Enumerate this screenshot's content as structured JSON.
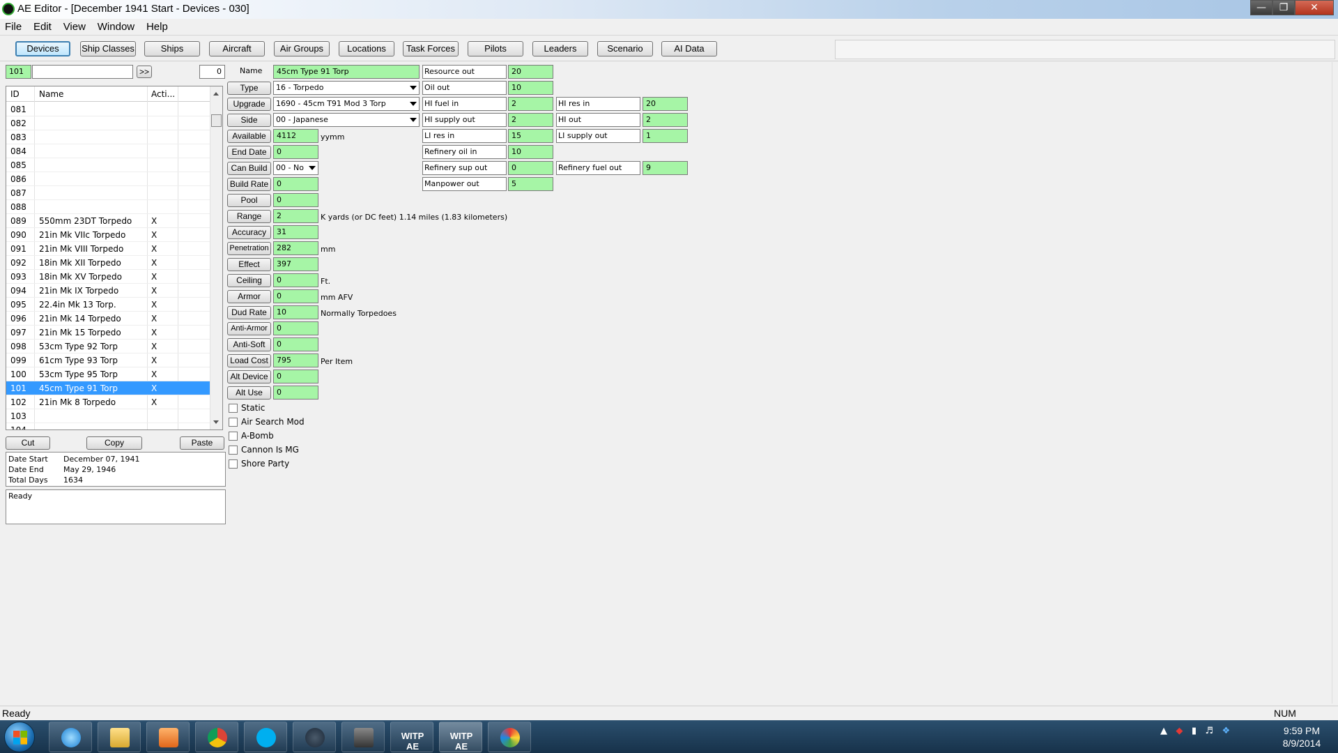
{
  "window": {
    "title": "AE Editor - [December 1941 Start - Devices - 030]"
  },
  "menu": [
    "File",
    "Edit",
    "View",
    "Window",
    "Help"
  ],
  "tabs": [
    "Devices",
    "Ship Classes",
    "Ships",
    "Aircraft",
    "Air Groups",
    "Locations",
    "Task Forces",
    "Pilots",
    "Leaders",
    "Scenario",
    "AI Data"
  ],
  "search": {
    "id_value": "101",
    "text_value": "",
    "go_label": ">>",
    "count_value": "0"
  },
  "list": {
    "headers": {
      "id": "ID",
      "name": "Name",
      "active": "Acti..."
    },
    "rows": [
      {
        "id": "081",
        "name": "",
        "active": ""
      },
      {
        "id": "082",
        "name": "",
        "active": ""
      },
      {
        "id": "083",
        "name": "",
        "active": ""
      },
      {
        "id": "084",
        "name": "",
        "active": ""
      },
      {
        "id": "085",
        "name": "",
        "active": ""
      },
      {
        "id": "086",
        "name": "",
        "active": ""
      },
      {
        "id": "087",
        "name": "",
        "active": ""
      },
      {
        "id": "088",
        "name": "",
        "active": ""
      },
      {
        "id": "089",
        "name": "550mm 23DT Torpedo",
        "active": "X"
      },
      {
        "id": "090",
        "name": "21in Mk VIIc Torpedo",
        "active": "X"
      },
      {
        "id": "091",
        "name": "21in Mk VIII Torpedo",
        "active": "X"
      },
      {
        "id": "092",
        "name": "18in Mk XII Torpedo",
        "active": "X"
      },
      {
        "id": "093",
        "name": "18in Mk XV Torpedo",
        "active": "X"
      },
      {
        "id": "094",
        "name": "21in Mk IX Torpedo",
        "active": "X"
      },
      {
        "id": "095",
        "name": "22.4in Mk 13 Torp.",
        "active": "X"
      },
      {
        "id": "096",
        "name": "21in Mk 14 Torpedo",
        "active": "X"
      },
      {
        "id": "097",
        "name": "21in Mk 15 Torpedo",
        "active": "X"
      },
      {
        "id": "098",
        "name": "53cm Type 92 Torp",
        "active": "X"
      },
      {
        "id": "099",
        "name": "61cm Type 93 Torp",
        "active": "X"
      },
      {
        "id": "100",
        "name": "53cm Type 95 Torp",
        "active": "X"
      },
      {
        "id": "101",
        "name": "45cm Type 91 Torp",
        "active": "X",
        "selected": true
      },
      {
        "id": "102",
        "name": "21in Mk 8 Torpedo",
        "active": "X"
      },
      {
        "id": "103",
        "name": "",
        "active": ""
      },
      {
        "id": "104",
        "name": "",
        "active": ""
      }
    ]
  },
  "clipboard": {
    "cut": "Cut",
    "copy": "Copy",
    "paste": "Paste"
  },
  "dates": {
    "start_label": "Date Start",
    "start_value": "December 07, 1941",
    "end_label": "Date End",
    "end_value": "May 29, 1946",
    "total_label": "Total Days",
    "total_value": "1634"
  },
  "status_box": "Ready",
  "form": {
    "name_label": "Name",
    "name_value": "45cm Type 91 Torp",
    "type_label": "Type",
    "type_value": "16 - Torpedo",
    "upgrade_label": "Upgrade",
    "upgrade_value": "1690 - 45cm T91 Mod 3 Torp",
    "side_label": "Side",
    "side_value": "00 - Japanese",
    "available_label": "Available",
    "available_value": "4112",
    "available_unit": "yymm",
    "enddate_label": "End Date",
    "enddate_value": "0",
    "canbuild_label": "Can Build",
    "canbuild_value": "00 - No",
    "buildrate_label": "Build Rate",
    "buildrate_value": "0",
    "pool_label": "Pool",
    "pool_value": "0",
    "range_label": "Range",
    "range_value": "2",
    "range_unit": "K yards  (or DC feet)  1.14 miles  (1.83 kilometers)",
    "accuracy_label": "Accuracy",
    "accuracy_value": "31",
    "penetration_label": "Penetration",
    "penetration_value": "282",
    "penetration_unit": "mm",
    "effect_label": "Effect",
    "effect_value": "397",
    "ceiling_label": "Ceiling",
    "ceiling_value": "0",
    "ceiling_unit": "Ft.",
    "armor_label": "Armor",
    "armor_value": "0",
    "armor_unit": "mm AFV",
    "dudrate_label": "Dud Rate",
    "dudrate_value": "10",
    "dudrate_unit": "Normally Torpedoes",
    "antiarmor_label": "Anti-Armor",
    "antiarmor_value": "0",
    "antisoft_label": "Anti-Soft",
    "antisoft_value": "0",
    "loadcost_label": "Load Cost",
    "loadcost_value": "795",
    "loadcost_unit": "Per Item",
    "altdevice_label": "Alt Device",
    "altdevice_value": "0",
    "altuse_label": "Alt Use",
    "altuse_value": "0"
  },
  "checkboxes": [
    "Static",
    "Air Search Mod",
    "A-Bomb",
    "Cannon Is MG",
    "Shore Party"
  ],
  "resources": {
    "resource_out_label": "Resource out",
    "resource_out_value": "20",
    "oil_out_label": "Oil out",
    "oil_out_value": "10",
    "hi_fuel_in_label": "HI fuel in",
    "hi_fuel_in_value": "2",
    "hi_supply_out_label": "HI supply out",
    "hi_supply_out_value": "2",
    "li_res_in_label": "LI res in",
    "li_res_in_value": "15",
    "refinery_oil_in_label": "Refinery oil in",
    "refinery_oil_in_value": "10",
    "refinery_sup_out_label": "Refinery sup out",
    "refinery_sup_out_value": "0",
    "manpower_out_label": "Manpower out",
    "manpower_out_value": "5",
    "hi_res_in_label": "HI res in",
    "hi_res_in_value": "20",
    "hi_out_label": "HI out",
    "hi_out_value": "2",
    "li_supply_out_label": "LI supply out",
    "li_supply_out_value": "1",
    "refinery_fuel_out_label": "Refinery fuel out",
    "refinery_fuel_out_value": "9"
  },
  "statusbar": {
    "text": "Ready",
    "num": "NUM"
  },
  "taskbar": {
    "items": [
      "start-icon",
      "internet-explorer-icon",
      "file-explorer-icon",
      "media-player-icon",
      "chrome-icon",
      "skype-icon",
      "steam-icon",
      "world-of-tanks-icon",
      "witp-ae-icon",
      "witp-ae-editor-icon",
      "paint-icon"
    ],
    "witp_label": "WITP AE",
    "time": "9:59 PM",
    "date": "8/9/2014"
  },
  "colors": {
    "field_green": "#a6f5a6",
    "selection": "#3399ff",
    "active_tab_border": "#3c7fb1"
  }
}
